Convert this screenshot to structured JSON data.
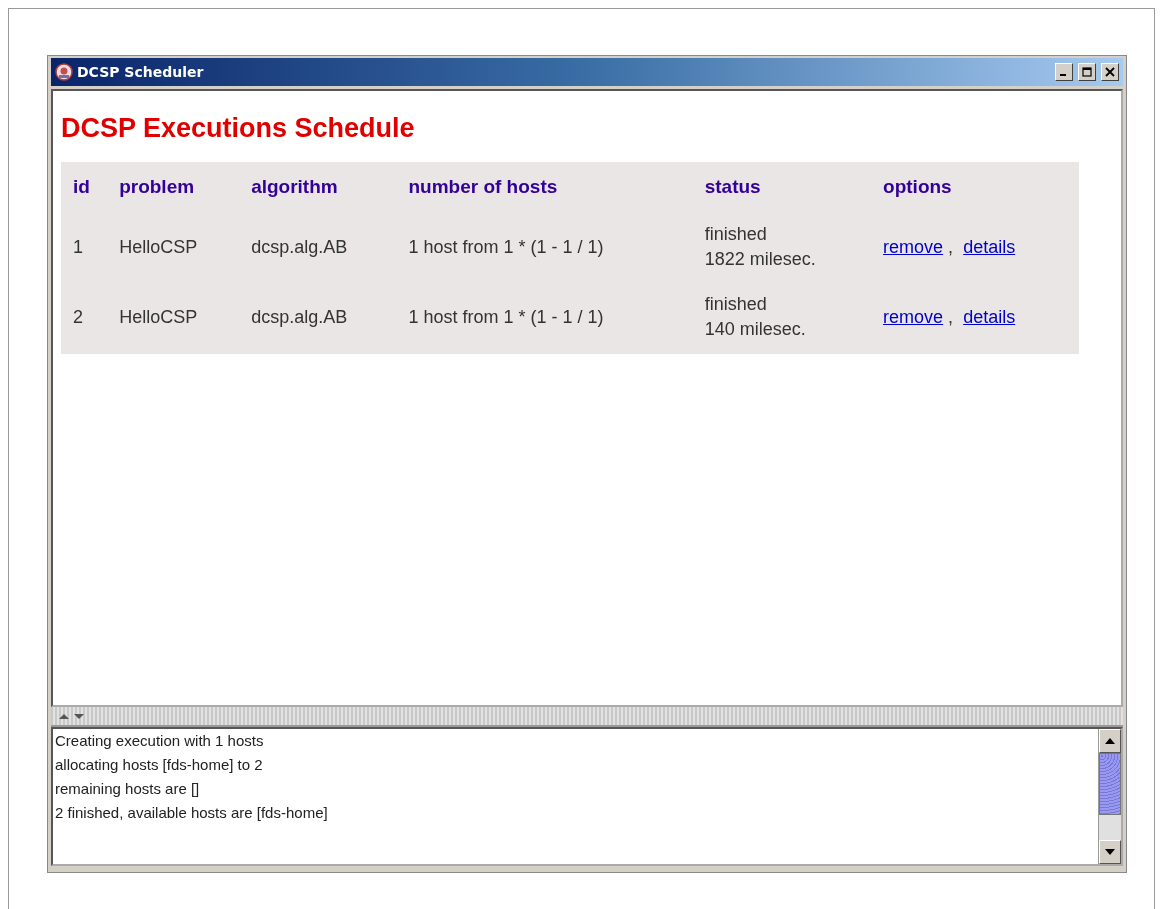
{
  "window": {
    "title": "DCSP Scheduler"
  },
  "heading": "DCSP Executions Schedule",
  "table": {
    "columns": [
      "id",
      "problem",
      "algorithm",
      "number of hosts",
      "status",
      "options"
    ],
    "rows": [
      {
        "id": "1",
        "problem": "HelloCSP",
        "algorithm": "dcsp.alg.AB",
        "hosts": "1 host from 1 * (1 - 1 / 1)",
        "status": [
          "finished",
          "1822 milesec."
        ],
        "options": {
          "links": [
            "remove",
            "details"
          ],
          "separator": ","
        }
      },
      {
        "id": "2",
        "problem": "HelloCSP",
        "algorithm": "dcsp.alg.AB",
        "hosts": "1 host from 1 * (1 - 1 / 1)",
        "status": [
          "finished",
          "140 milesec."
        ],
        "options": {
          "links": [
            "remove",
            "details"
          ],
          "separator": ","
        }
      }
    ]
  },
  "log": {
    "lines": [
      "Creating execution with 1 hosts",
      "allocating hosts [fds-home] to 2",
      "remaining hosts are []",
      "2 finished, available hosts are [fds-home]"
    ]
  }
}
